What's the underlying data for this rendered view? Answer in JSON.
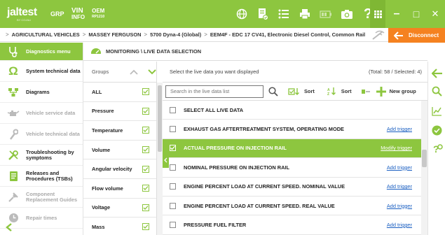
{
  "topbar": {
    "logo": "jaltest",
    "logo_sub": "BY COJALI",
    "grp": "GRP",
    "vin_top": "VIN",
    "vin_bottom": "INFO",
    "oem_top": "OEM",
    "oem_bottom": "RP1210",
    "icons": [
      "globe-icon",
      "document-check-icon",
      "list-icon",
      "printer-icon",
      "battery-icon",
      "camera-icon",
      "help-icon"
    ],
    "grid_icon": "apps-grid-icon",
    "minimize": "–",
    "maximize": "□",
    "close": "✕"
  },
  "breadcrumb": {
    "items": [
      "AGRICULTURAL VEHICLES",
      "MASSEY FERGUSON",
      "5700 Dyna-4 (Global)",
      "EEM4F - EDC 17 CV41, Electronic Diesel Control, Common Rail"
    ],
    "separator": ">"
  },
  "disconnect": {
    "label": "Disconnect"
  },
  "sidebar": {
    "items": [
      {
        "label": "Diagnostics menu",
        "icon": "stethoscope-icon",
        "state": "active"
      },
      {
        "label": "System technical data",
        "icon": "ohm-icon",
        "state": "normal"
      },
      {
        "label": "Diagrams",
        "icon": "diagram-icon",
        "state": "normal"
      },
      {
        "label": "Vehicle service data",
        "icon": "oil-can-icon",
        "state": "disabled"
      },
      {
        "label": "Vehicle technical data",
        "icon": "wrench-icon",
        "state": "disabled"
      },
      {
        "label": "Troubleshooting by symptoms",
        "icon": "tools-icon",
        "state": "normal"
      },
      {
        "label": "Releases and Procedures (TSBs)",
        "icon": "bulletin-icon",
        "state": "normal"
      },
      {
        "label": "Component Replacement Guides",
        "icon": "component-icon",
        "state": "disabled"
      },
      {
        "label": "Repair times",
        "icon": "clock-icon",
        "state": "disabled"
      }
    ],
    "back_icon": "back-chevron-icon"
  },
  "page": {
    "title": "MONITORING \\ LIVE DATA SELECTION"
  },
  "groups": {
    "header": "Groups",
    "items": [
      {
        "label": "ALL"
      },
      {
        "label": "Pressure"
      },
      {
        "label": "Temperature"
      },
      {
        "label": "Volume"
      },
      {
        "label": "Angular velocity"
      },
      {
        "label": "Flow volume"
      },
      {
        "label": "Voltage"
      },
      {
        "label": "Mass"
      }
    ]
  },
  "live_data": {
    "instruction": "Select the live data you want displayed",
    "totals": "(Total: 58 / Selected: 4)",
    "search_placeholder": "Search in the live data list",
    "sort1": "Sort",
    "sort2": "Sort",
    "new_group": "New group",
    "rows": [
      {
        "label": "SELECT ALL LIVE DATA",
        "checked": false,
        "selected": false,
        "trigger": ""
      },
      {
        "label": "EXHAUST GAS AFTERTREATMENT SYSTEM, OPERATING MODE",
        "checked": false,
        "selected": false,
        "trigger": "Add trigger"
      },
      {
        "label": "ACTUAL PRESSURE ON INJECTION RAIL",
        "checked": true,
        "selected": true,
        "trigger": "Modify trigger"
      },
      {
        "label": "NOMINAL PRESSURE ON INJECTION RAIL",
        "checked": false,
        "selected": false,
        "trigger": "Add trigger"
      },
      {
        "label": "ENGINE PERCENT LOAD AT CURRENT SPEED. NOMINAL VALUE",
        "checked": false,
        "selected": false,
        "trigger": "Add trigger"
      },
      {
        "label": "ENGINE PERCENT LOAD AT CURRENT SPEED. REAL VALUE",
        "checked": false,
        "selected": false,
        "trigger": "Add trigger"
      },
      {
        "label": "PRESSURE FUEL FILTER",
        "checked": false,
        "selected": false,
        "trigger": "Add trigger"
      }
    ]
  },
  "rail": {
    "icons": [
      "arrow-left-icon",
      "search-icon",
      "chart-icon",
      "check-circle-icon",
      "question-gear-icon"
    ]
  },
  "colors": {
    "brand_green": "#8dc63f",
    "accent_orange": "#f58220",
    "link_blue": "#1a5fc2"
  }
}
